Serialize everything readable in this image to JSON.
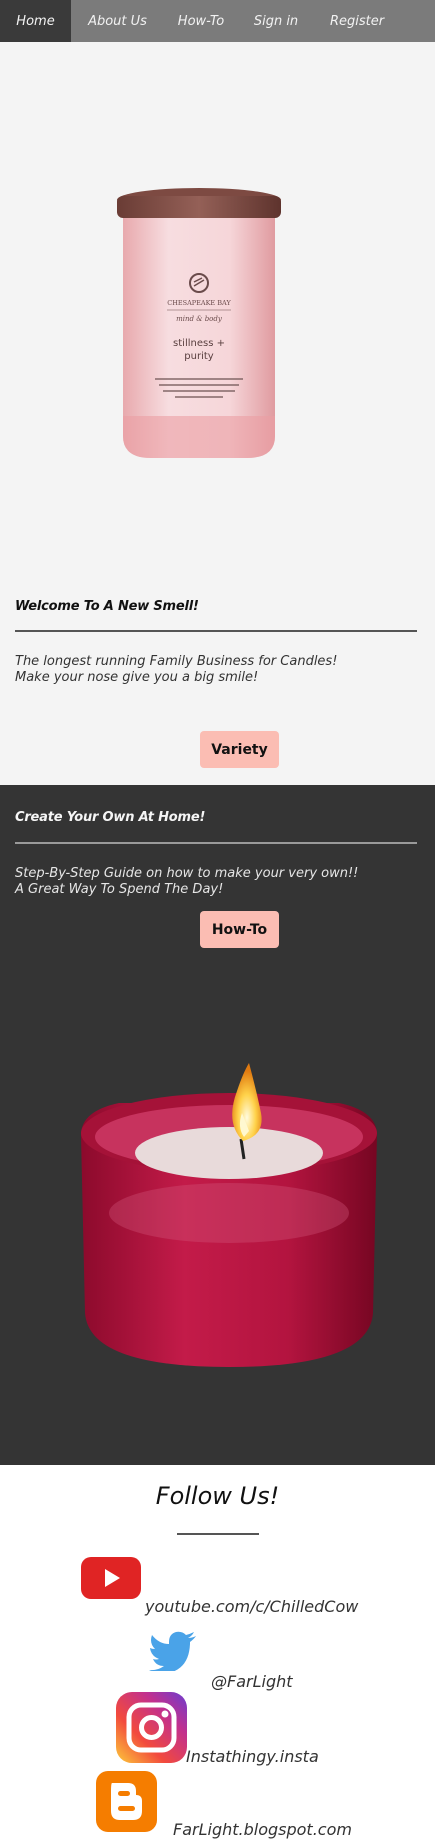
{
  "nav": {
    "items": [
      "Home",
      "About Us",
      "How-To",
      "Sign in",
      "Register"
    ],
    "active": "Home"
  },
  "product_jar": {
    "brand": "CHESAPEAKE BAY",
    "subbrand": "mind & body",
    "scent_line1": "stillness +",
    "scent_line2": "purity"
  },
  "welcome": {
    "title": "Welcome To A New Smell!",
    "line1": "The longest running Family Business for Candles!",
    "line2": "Make your nose give you a big smile!",
    "button": "Variety"
  },
  "create": {
    "title": "Create Your Own At Home!",
    "line1": "Step-By-Step Guide on how to make your very own!!",
    "line2": "A Great Way To Spend The Day!",
    "button": "How-To"
  },
  "follow": {
    "title": "Follow Us!",
    "youtube": "youtube.com/c/ChilledCow",
    "twitter": "@FarLight",
    "instagram": "Instathingy.insta",
    "blogger": "FarLight.blogspot.com"
  },
  "colors": {
    "nav_bg": "#7b7b7b",
    "nav_active": "#3a3a3a",
    "button_bg": "#fbbdb3",
    "dark_section": "#343434"
  }
}
